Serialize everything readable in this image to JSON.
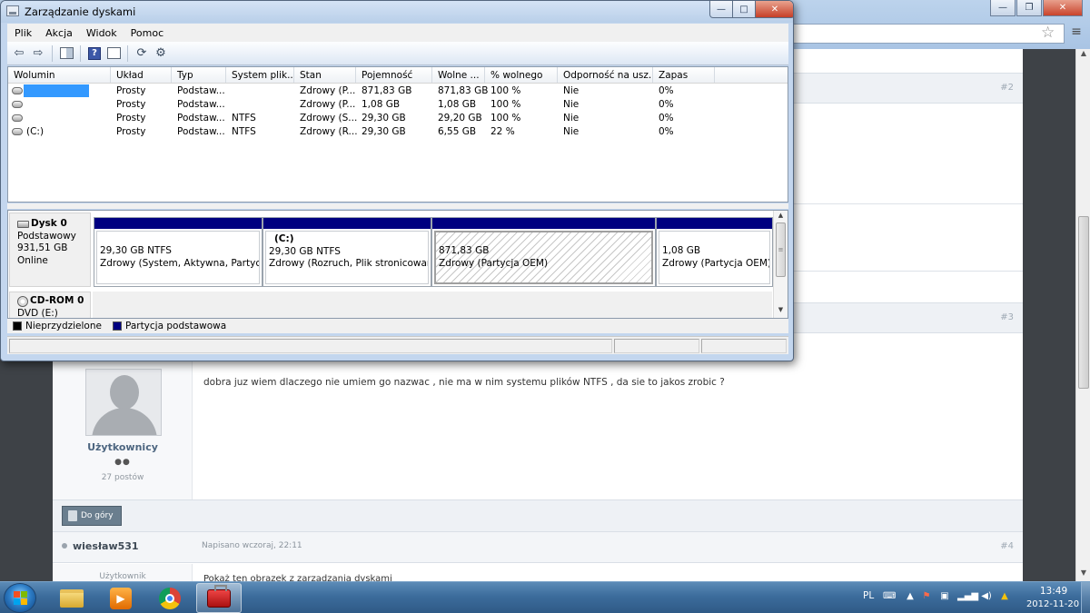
{
  "browser": {
    "controls": {
      "min": "—",
      "max": "❐",
      "close": "✕"
    },
    "bookmark_icon": "star-icon",
    "menu_glyph": "≡"
  },
  "forum": {
    "posts": [
      {
        "number": "#2"
      },
      {
        "number": "#3",
        "user": {
          "name": "Użytkownicy",
          "rank_dots": "●●",
          "post_count": "27 postów"
        },
        "text": "dobra juz wiem dlaczego nie umiem go nazwac , nie ma w nim systemu plików NTFS , da sie to jakos zrobic ?"
      },
      {
        "number": "#4",
        "author": "wiesław531",
        "date": "Napisano wczoraj, 22:11",
        "role": "Użytkownik",
        "text": "Pokaż ten obrazek z zarządzania dyskami"
      }
    ],
    "top_button_label": "Do góry"
  },
  "window": {
    "title": "Zarządzanie dyskami",
    "controls": {
      "min": "—",
      "max": "□",
      "close": "✕"
    },
    "menu": [
      "Plik",
      "Akcja",
      "Widok",
      "Pomoc"
    ],
    "toolbar": [
      "back-arrow-icon",
      "forward-arrow-icon",
      "properties-icon",
      "help-icon",
      "console-tree-icon",
      "refresh-icon",
      "settings-icon"
    ],
    "columns": [
      "Wolumin",
      "Układ",
      "Typ",
      "System plik...",
      "Stan",
      "Pojemność",
      "Wolne ...",
      "% wolnego",
      "Odporność na usz...",
      "Zapas"
    ],
    "volumes": [
      {
        "name": "",
        "layout": "Prosty",
        "type": "Podstaw...",
        "fs": "",
        "status": "Zdrowy (P...",
        "capacity": "871,83 GB",
        "free": "871,83 GB",
        "pct_free": "100 %",
        "fault": "Nie",
        "overhead": "0%"
      },
      {
        "name": "",
        "layout": "Prosty",
        "type": "Podstaw...",
        "fs": "",
        "status": "Zdrowy (P...",
        "capacity": "1,08 GB",
        "free": "1,08 GB",
        "pct_free": "100 %",
        "fault": "Nie",
        "overhead": "0%"
      },
      {
        "name": "",
        "layout": "Prosty",
        "type": "Podstaw...",
        "fs": "NTFS",
        "status": "Zdrowy (S...",
        "capacity": "29,30 GB",
        "free": "29,20 GB",
        "pct_free": "100 %",
        "fault": "Nie",
        "overhead": "0%"
      },
      {
        "name": "(C:)",
        "layout": "Prosty",
        "type": "Podstaw...",
        "fs": "NTFS",
        "status": "Zdrowy (R...",
        "capacity": "29,30 GB",
        "free": "6,55 GB",
        "pct_free": "22 %",
        "fault": "Nie",
        "overhead": "0%"
      }
    ],
    "disk0": {
      "name": "Dysk 0",
      "type": "Podstawowy",
      "size": "931,51 GB",
      "state": "Online",
      "partitions": [
        {
          "label": "",
          "size": "29,30 GB NTFS",
          "status": "Zdrowy (System, Aktywna, Partycja p"
        },
        {
          "label": "(C:)",
          "size": "29,30 GB NTFS",
          "status": "Zdrowy (Rozruch, Plik stronicowania,"
        },
        {
          "label": "",
          "size": "871,83 GB",
          "status": "Zdrowy (Partycja OEM)"
        },
        {
          "label": "",
          "size": "1,08 GB",
          "status": "Zdrowy (Partycja OEM)"
        }
      ]
    },
    "cdrom": {
      "name": "CD-ROM 0",
      "drive": "DVD (E:)"
    },
    "legend": [
      {
        "label": "Nieprzydzielone",
        "color": "#000000"
      },
      {
        "label": "Partycja podstawowa",
        "color": "#000080"
      }
    ]
  },
  "taskbar": {
    "apps": [
      "folder-icon",
      "media-center-icon",
      "chrome-icon",
      "toolbox-icon"
    ],
    "tray": {
      "language": "PL",
      "icons": [
        "keyboard-icon",
        "warning-flag-icon",
        "network-icon",
        "speaker-icon",
        "signal-icon",
        "gdrive-icon"
      ],
      "time": "13:49",
      "date": "2012-11-20"
    }
  }
}
